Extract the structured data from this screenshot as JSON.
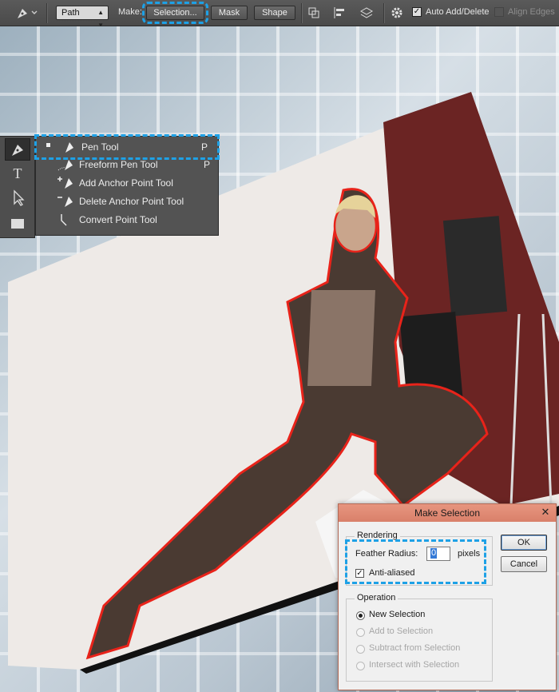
{
  "options_bar": {
    "mode_select": "Path",
    "make_label": "Make:",
    "selection_button": "Selection...",
    "mask_button": "Mask",
    "shape_button": "Shape",
    "auto_add_delete": {
      "label": "Auto Add/Delete",
      "checked": true
    },
    "align_edges": {
      "label": "Align Edges",
      "checked": false
    }
  },
  "tools": [
    "pen-tool",
    "type-tool",
    "path-selection-tool",
    "rectangle-tool"
  ],
  "flyout": {
    "items": [
      {
        "label": "Pen Tool",
        "key": "P",
        "icon": "pen-icon",
        "selected": true
      },
      {
        "label": "Freeform Pen Tool",
        "key": "P",
        "icon": "freeform-pen-icon",
        "selected": false
      },
      {
        "label": "Add Anchor Point Tool",
        "key": "",
        "icon": "add-anchor-icon",
        "selected": false
      },
      {
        "label": "Delete Anchor Point Tool",
        "key": "",
        "icon": "delete-anchor-icon",
        "selected": false
      },
      {
        "label": "Convert Point Tool",
        "key": "",
        "icon": "convert-point-icon",
        "selected": false
      }
    ]
  },
  "dialog": {
    "title": "Make Selection",
    "rendering": {
      "legend": "Rendering",
      "feather_label": "Feather Radius:",
      "feather_value": "0",
      "feather_unit": "pixels",
      "anti_aliased_label": "Anti-aliased",
      "anti_aliased_checked": true
    },
    "operation": {
      "legend": "Operation",
      "options": [
        {
          "label": "New Selection",
          "selected": true,
          "enabled": true
        },
        {
          "label": "Add to Selection",
          "selected": false,
          "enabled": false
        },
        {
          "label": "Subtract from Selection",
          "selected": false,
          "enabled": false
        },
        {
          "label": "Intersect with Selection",
          "selected": false,
          "enabled": false
        }
      ]
    },
    "ok_button": "OK",
    "cancel_button": "Cancel"
  },
  "colors": {
    "highlight": "#1ea1e6",
    "path_outline": "#e8231a",
    "dialog_title": "#e08a73"
  }
}
